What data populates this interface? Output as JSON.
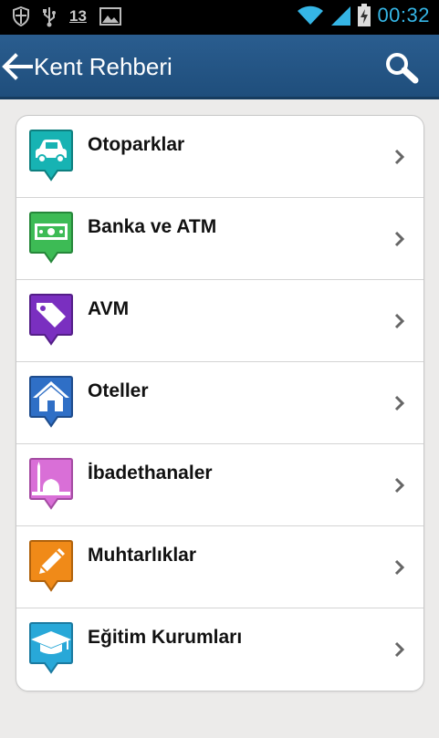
{
  "statusbar": {
    "notification_count": "13",
    "time": "00:32"
  },
  "header": {
    "title": "Kent Rehberi",
    "back_icon": "arrow-left-icon",
    "search_icon": "search-icon"
  },
  "categories": [
    {
      "label": "Otoparklar",
      "icon": "car-icon",
      "color": "#17b3b3"
    },
    {
      "label": "Banka ve ATM",
      "icon": "money-icon",
      "color": "#3dbb55"
    },
    {
      "label": "AVM",
      "icon": "tag-icon",
      "color": "#7a2fc0"
    },
    {
      "label": "Oteller",
      "icon": "home-icon",
      "color": "#2f6fc6"
    },
    {
      "label": "İbadethanaler",
      "icon": "mosque-icon",
      "color": "#d96fd7"
    },
    {
      "label": "Muhtarlıklar",
      "icon": "pencil-icon",
      "color": "#f08a18"
    },
    {
      "label": "Eğitim Kurumları",
      "icon": "graduation-cap-icon",
      "color": "#28a8d8"
    }
  ]
}
